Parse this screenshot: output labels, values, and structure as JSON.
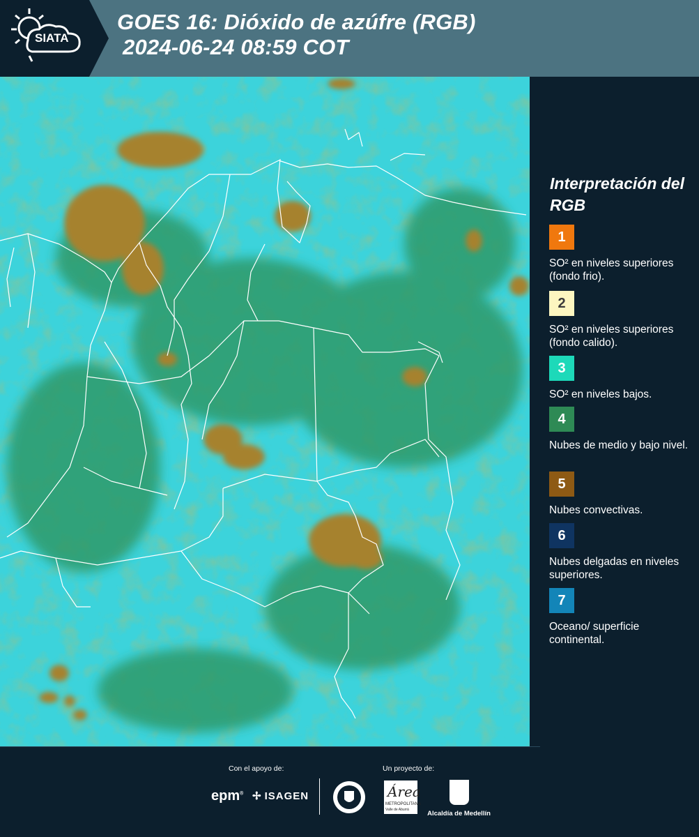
{
  "header": {
    "logo_text": "SIATA",
    "title_line1": "GOES 16: Dióxido de azúfre (RGB)",
    "title_line2": "2024-06-24 08:59 COT"
  },
  "legend": {
    "title": "Interpretación del RGB",
    "items": [
      {
        "number": "1",
        "color": "#f0780e",
        "text": "SO² en niveles superiores (fondo frio)."
      },
      {
        "number": "2",
        "color": "#fdf6c0",
        "text": "SO² en niveles superiores (fondo calido)."
      },
      {
        "number": "3",
        "color": "#1dd9b9",
        "text": "SO² en niveles bajos."
      },
      {
        "number": "4",
        "color": "#2e8a55",
        "text": "Nubes de medio y bajo nivel."
      },
      {
        "number": "5",
        "color": "#8e5a14",
        "text": "Nubes convectivas."
      },
      {
        "number": "6",
        "color": "#0f3461",
        "text": "Nubes delgadas en niveles superiores."
      },
      {
        "number": "7",
        "color": "#1385b8",
        "text": "Oceano/ superficie continental."
      }
    ]
  },
  "map": {
    "background_color": "#3cd3db",
    "low_cloud_color": "#2d9a6a",
    "convective_color": "#a6822e",
    "border_color": "#ffffff"
  },
  "footer": {
    "support_label": "Con el apoyo de:",
    "project_label": "Un proyecto de:",
    "epm": "epm",
    "isagen": "ISAGEN",
    "area_logo": "Área",
    "area_sub1": "METROPOLITANA",
    "area_sub2": "Valle de Aburrá",
    "alcaldia": "Alcaldía de Medellín"
  }
}
